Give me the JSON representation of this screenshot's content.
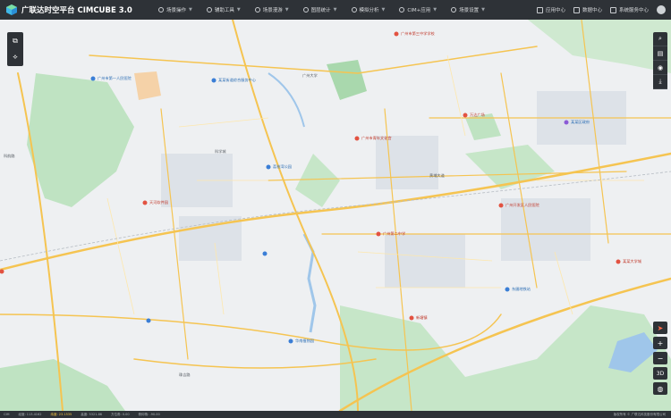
{
  "app": {
    "title": "广联达时空平台 CIMCUBE 3.0"
  },
  "menu": [
    {
      "label": "场景操作",
      "icon": "scene-icon"
    },
    {
      "label": "辅助工具",
      "icon": "tools-icon"
    },
    {
      "label": "场景漫游",
      "icon": "roam-icon"
    },
    {
      "label": "图层统计",
      "icon": "stats-icon"
    },
    {
      "label": "模拟分析",
      "icon": "analysis-icon"
    },
    {
      "label": "CIM+应用",
      "icon": "apps-icon"
    },
    {
      "label": "场景设置",
      "icon": "settings-icon"
    }
  ],
  "right_tools": [
    {
      "label": "应用中心",
      "icon": "app-center-icon"
    },
    {
      "label": "数据中心",
      "icon": "data-center-icon"
    },
    {
      "label": "系统服务中心",
      "icon": "service-icon"
    }
  ],
  "map_labels": [
    {
      "text": "广州市第三中学学校",
      "color": "red"
    },
    {
      "text": "广州市第一人民医院",
      "color": "blue"
    },
    {
      "text": "某某街道综合服务中心",
      "color": "blue"
    },
    {
      "text": "广州大学",
      "color": "gray"
    },
    {
      "text": "万达广场",
      "color": "red"
    },
    {
      "text": "广州市青年文化宫",
      "color": "red"
    },
    {
      "text": "某某区政府",
      "color": "blue"
    },
    {
      "text": "天河软件园",
      "color": "red"
    },
    {
      "text": "荔枝湾公园",
      "color": "blue"
    },
    {
      "text": "科学城",
      "color": "gray"
    },
    {
      "text": "黄埔大道",
      "color": "gray"
    },
    {
      "text": "广州开发区人民医院",
      "color": "red"
    },
    {
      "text": "东圃地铁站",
      "color": "blue"
    },
    {
      "text": "华南植物园",
      "color": "blue"
    },
    {
      "text": "广州第二中学",
      "color": "red"
    },
    {
      "text": "新塘镇",
      "color": "red"
    },
    {
      "text": "科韵路",
      "color": "gray"
    },
    {
      "text": "珠吉路",
      "color": "gray"
    },
    {
      "text": "某某大学城",
      "color": "red"
    }
  ],
  "left_tools": [
    {
      "icon": "layers-icon"
    },
    {
      "icon": "measure-icon"
    }
  ],
  "right_map_tools": [
    {
      "icon": "search-icon"
    },
    {
      "icon": "building-icon"
    },
    {
      "icon": "camera-icon"
    },
    {
      "icon": "download-icon"
    }
  ],
  "zoom": {
    "compass": "compass-icon",
    "in": "+",
    "out": "−",
    "mode": "3D",
    "globe": "globe-icon"
  },
  "status": {
    "left": "CIM",
    "items": [
      "经度: 113.4162",
      "纬度: 23.1535",
      "高度: 5321.86",
      "方位角: 0.00",
      "俯仰角: -90.00"
    ],
    "right": "版权所有 © 广联达科技股份有限公司"
  }
}
